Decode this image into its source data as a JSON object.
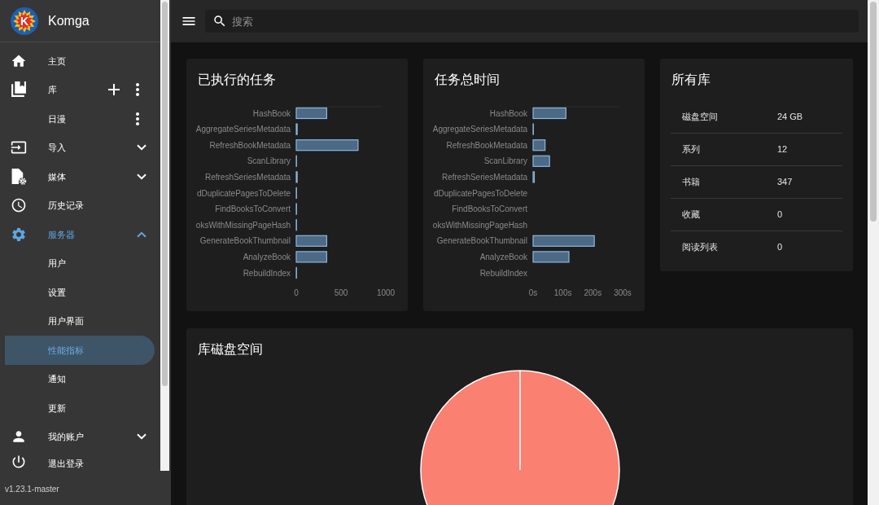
{
  "sidebar": {
    "app_name": "Komga",
    "logo_letter": "K",
    "items": [
      {
        "kind": "link",
        "label": "主页",
        "selected": false
      },
      {
        "kind": "libraries",
        "label": "库",
        "selected": false,
        "children": [
          {
            "label": "日漫",
            "selected": false
          }
        ]
      },
      {
        "kind": "group",
        "label": "导入",
        "expanded": false
      },
      {
        "kind": "group",
        "label": "媒体",
        "expanded": false
      },
      {
        "kind": "link",
        "label": "历史记录",
        "selected": false
      },
      {
        "kind": "group",
        "label": "服务器",
        "expanded": true,
        "children": [
          {
            "label": "用户",
            "selected": false
          },
          {
            "label": "设置",
            "selected": false
          },
          {
            "label": "用户界面",
            "selected": false
          },
          {
            "label": "性能指标",
            "selected": true
          },
          {
            "label": "通知",
            "selected": false
          },
          {
            "label": "更新",
            "selected": false
          }
        ]
      },
      {
        "kind": "group",
        "label": "我的账户",
        "expanded": false
      },
      {
        "kind": "link",
        "label": "退出登录",
        "selected": false
      }
    ],
    "version": "v1.23.1-master"
  },
  "topbar": {
    "search": {
      "placeholder": "搜索"
    }
  },
  "tasks_count_card": {
    "title": "已执行的任务",
    "chart_data": {
      "type": "bar",
      "orientation": "horizontal",
      "categories": [
        "HashBook",
        "AggregateSeriesMetadata",
        "RefreshBookMetadata",
        "ScanLibrary",
        "RefreshSeriesMetadata",
        "dDuplicatePagesToDelete",
        "FindBooksToConvert",
        "oksWithMissingPageHash",
        "GenerateBookThumbnail",
        "AnalyzeBook",
        "RebuildIndex"
      ],
      "values": [
        340,
        10,
        690,
        2,
        10,
        1,
        1,
        1,
        340,
        340,
        1
      ],
      "xlim": [
        0,
        1000
      ],
      "xticks": [
        0,
        500,
        1000
      ]
    }
  },
  "tasks_time_card": {
    "title": "任务总时间",
    "chart_data": {
      "type": "bar",
      "orientation": "horizontal",
      "categories": [
        "HashBook",
        "AggregateSeriesMetadata",
        "RefreshBookMetadata",
        "ScanLibrary",
        "RefreshSeriesMetadata",
        "dDuplicatePagesToDelete",
        "FindBooksToConvert",
        "oksWithMissingPageHash",
        "GenerateBookThumbnail",
        "AnalyzeBook",
        "RebuildIndex"
      ],
      "values": [
        110,
        1,
        40,
        55,
        4,
        0,
        0,
        0,
        205,
        120,
        0
      ],
      "xlim": [
        0,
        300
      ],
      "xticks": [
        {
          "value": 0,
          "label": "0s"
        },
        {
          "value": 100,
          "label": "100s"
        },
        {
          "value": 200,
          "label": "200s"
        },
        {
          "value": 300,
          "label": "300s"
        }
      ]
    }
  },
  "all_libraries_card": {
    "title": "所有库",
    "rows": [
      {
        "label": "磁盘空间",
        "value": "24 GB"
      },
      {
        "label": "系列",
        "value": "12"
      },
      {
        "label": "书籍",
        "value": "347"
      },
      {
        "label": "收藏",
        "value": "0"
      },
      {
        "label": "阅读列表",
        "value": "0"
      }
    ]
  },
  "library_disk_space_card": {
    "title": "库磁盘空间"
  }
}
